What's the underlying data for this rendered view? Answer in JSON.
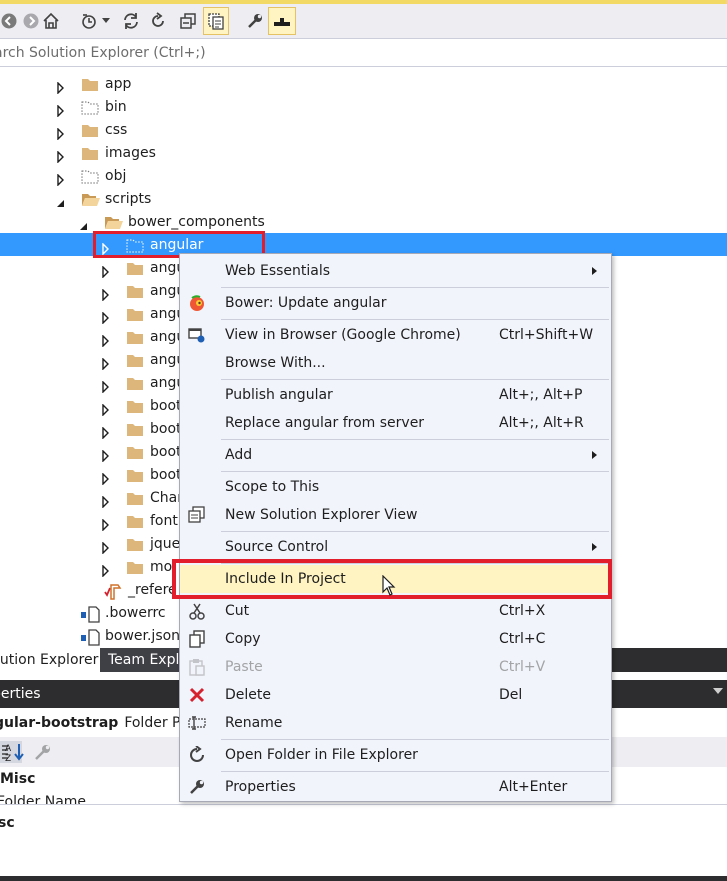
{
  "search": {
    "placeholder": "arch Solution Explorer (Ctrl+;)"
  },
  "tree": {
    "items": [
      {
        "label": "app"
      },
      {
        "label": "bin"
      },
      {
        "label": "css"
      },
      {
        "label": "images"
      },
      {
        "label": "obj"
      },
      {
        "label": "scripts"
      },
      {
        "label": "bower_components"
      },
      {
        "label": "angular"
      },
      {
        "label": "angu"
      },
      {
        "label": "angu"
      },
      {
        "label": "angu"
      },
      {
        "label": "angu"
      },
      {
        "label": "angu"
      },
      {
        "label": "angu"
      },
      {
        "label": "boot"
      },
      {
        "label": "boot"
      },
      {
        "label": "boot"
      },
      {
        "label": "boot"
      },
      {
        "label": "Char"
      },
      {
        "label": "font"
      },
      {
        "label": "jque"
      },
      {
        "label": "mo"
      },
      {
        "label": "_refere"
      },
      {
        "label": ".bowerrc"
      },
      {
        "label": "bower.json"
      }
    ]
  },
  "tabs": {
    "solution_explorer": "lution Explorer",
    "team_explorer": "Team Exple"
  },
  "properties": {
    "title": "perties",
    "object_name": "gular-bootstrap",
    "object_type": "Folder Pro",
    "category": "Misc",
    "row_name": "Folder Name",
    "desc_title": "sc"
  },
  "menu": {
    "web_essentials": "Web Essentials",
    "bower_update": "Bower: Update angular",
    "view_in_browser": "View in Browser (Google Chrome)",
    "view_in_browser_sc": "Ctrl+Shift+W",
    "browse_with": "Browse With...",
    "publish": "Publish angular",
    "publish_sc": "Alt+;, Alt+P",
    "replace": "Replace angular from server",
    "replace_sc": "Alt+;, Alt+R",
    "add": "Add",
    "scope": "Scope to This",
    "new_view": "New Solution Explorer View",
    "source_control": "Source Control",
    "include": "Include In Project",
    "cut": "Cut",
    "cut_sc": "Ctrl+X",
    "copy": "Copy",
    "copy_sc": "Ctrl+C",
    "paste": "Paste",
    "paste_sc": "Ctrl+V",
    "delete": "Delete",
    "delete_sc": "Del",
    "rename": "Rename",
    "open_folder": "Open Folder in File Explorer",
    "properties": "Properties",
    "properties_sc": "Alt+Enter"
  },
  "colors": {
    "selection": "#3399ff",
    "highlight_border": "#e21d2c",
    "menu_bg": "#f2f4fc",
    "menu_hover": "#fff4c2"
  }
}
